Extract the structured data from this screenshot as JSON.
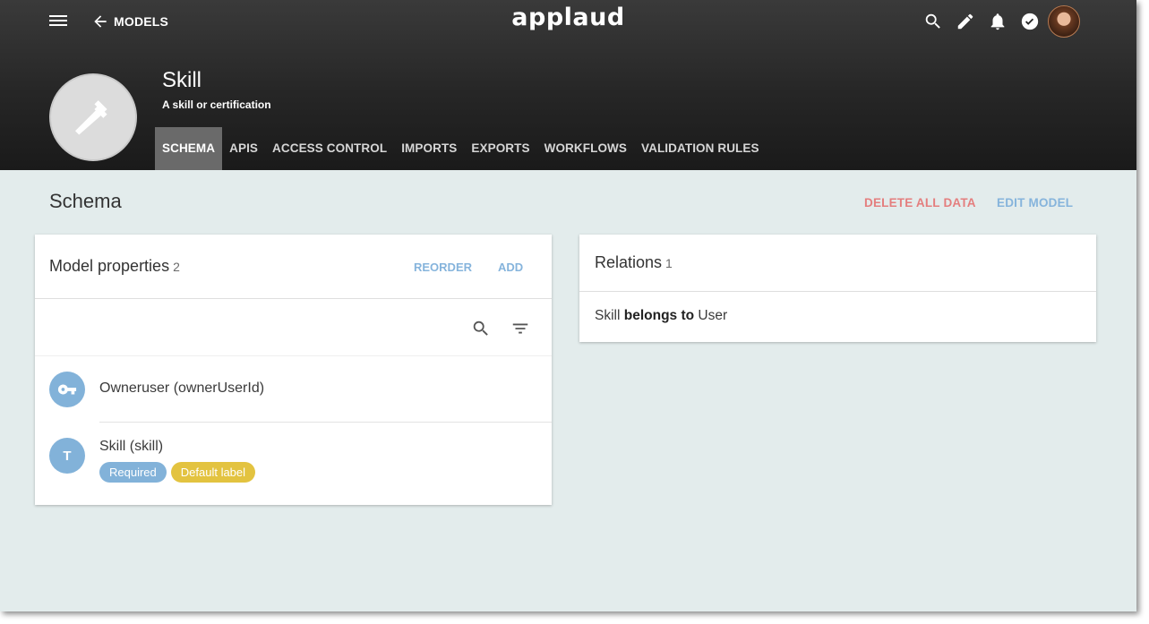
{
  "header": {
    "back_label": "MODELS",
    "brand": "applaud",
    "model_title": "Skill",
    "model_subtitle": "A skill or certification",
    "tabs": [
      {
        "label": "SCHEMA"
      },
      {
        "label": "APIS"
      },
      {
        "label": "ACCESS CONTROL"
      },
      {
        "label": "IMPORTS"
      },
      {
        "label": "EXPORTS"
      },
      {
        "label": "WORKFLOWS"
      },
      {
        "label": "VALIDATION RULES"
      }
    ],
    "active_tab": "SCHEMA",
    "icons": [
      "menu-icon",
      "arrow-back-icon",
      "search-icon",
      "pencil-icon",
      "bell-icon",
      "check-circle-icon",
      "avatar",
      "hammer-icon"
    ]
  },
  "content": {
    "section_title": "Schema",
    "delete_all_label": "DELETE ALL DATA",
    "edit_model_label": "EDIT MODEL"
  },
  "properties": {
    "title": "Model properties",
    "count": "2",
    "reorder_label": "REORDER",
    "add_label": "ADD",
    "items": [
      {
        "name": "Owneruser (ownerUserId)",
        "icon": "key-icon"
      },
      {
        "name": "Skill (skill)",
        "icon_letter": "T",
        "badges": [
          {
            "label": "Required",
            "color": "#82b2d9"
          },
          {
            "label": "Default label",
            "color": "#e3c340"
          }
        ]
      }
    ]
  },
  "relations": {
    "title": "Relations",
    "count": "1",
    "items": [
      {
        "subject": "Skill",
        "verb": "belongs to",
        "object": "User"
      }
    ]
  },
  "colors": {
    "header_bg": "#262626",
    "content_bg": "#e3ecec",
    "accent_blue": "#86b4dc",
    "danger_red": "#e47e7e",
    "badge_yellow": "#e3c340"
  }
}
